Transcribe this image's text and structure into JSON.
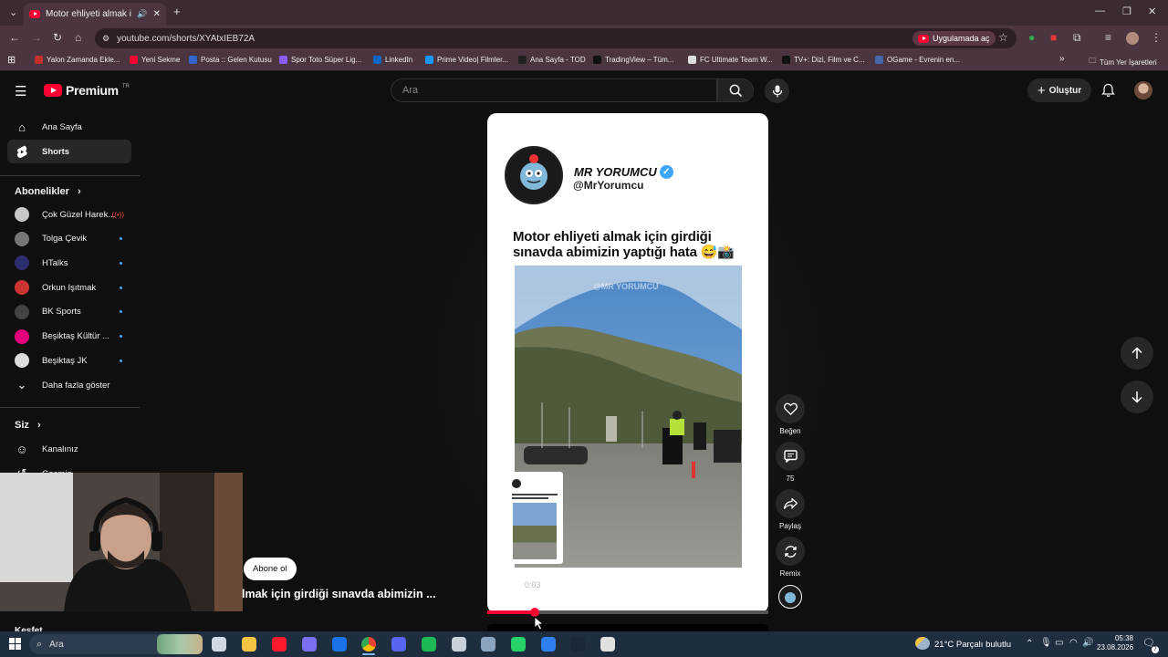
{
  "browser": {
    "tab_title": "Motor ehliyeti almak için gi",
    "url": "youtube.com/shorts/XYAtxIEB72A",
    "open_in_app": "Uygulamada aç",
    "all_bookmarks": "Tüm Yer İşaretleri",
    "bookmarks": [
      {
        "label": "Yalon Zamanda Ekle...",
        "color": "#c4302b"
      },
      {
        "label": "Yeni Sekme",
        "color": "#ff0033"
      },
      {
        "label": "Posta :: Gelen Kutusu",
        "color": "#3366cc"
      },
      {
        "label": "Spor Toto Süper Lig...",
        "color": "#8a5cf6"
      },
      {
        "label": "LinkedIn",
        "color": "#0a66c2"
      },
      {
        "label": "Prime Video| Filmler...",
        "color": "#1a98ff"
      },
      {
        "label": "Ana Sayfa - TOD",
        "color": "#222222"
      },
      {
        "label": "TradingView – Tüm...",
        "color": "#111111"
      },
      {
        "label": "FC Ultimate Team W...",
        "color": "#dddddd"
      },
      {
        "label": "TV+: Dizi, Film ve C...",
        "color": "#111111"
      },
      {
        "label": "OGame - Evrenin en...",
        "color": "#4466aa"
      }
    ]
  },
  "youtube": {
    "logo_text": "Premium",
    "logo_sup": "TR",
    "search_placeholder": "Ara",
    "create_label": "Oluştur"
  },
  "sidebar": {
    "home": "Ana Sayfa",
    "shorts": "Shorts",
    "subs_header": "Abonelikler",
    "subs": [
      {
        "name": "Çok Güzel Harek...",
        "color": "#c8c8c8",
        "live": true
      },
      {
        "name": "Tolga Çevik",
        "color": "#777777",
        "live": false
      },
      {
        "name": "HTalks",
        "color": "#2d2d6b",
        "live": false
      },
      {
        "name": "Orkun Işıtmak",
        "color": "#cc3333",
        "live": false
      },
      {
        "name": "BK Sports",
        "color": "#444444",
        "live": false
      },
      {
        "name": "Beşiktaş Kültür ...",
        "color": "#e6007e",
        "live": false
      },
      {
        "name": "Beşiktaş JK",
        "color": "#dddddd",
        "live": false
      }
    ],
    "show_more": "Daha fazla göster",
    "you_header": "Siz",
    "channel": "Kanalınız",
    "history": "Geçmiş",
    "explore_header": "Keşfet"
  },
  "short": {
    "channel_name": "MR YORUMCU",
    "handle": "@MrYorumcu",
    "caption": "Motor ehliyeti almak için girdiği sınavda abimizin yaptığı hata 😅📸",
    "watermark": "@MR YORUMCU",
    "timestamp": "0:03",
    "progress": 0.17,
    "overlay_title": "lmak için girdiği sınavda abimizin ...",
    "subscribe": "Abone ol",
    "like": "Beğen",
    "comments": "75",
    "share": "Paylaş",
    "remix": "Remix"
  },
  "taskbar": {
    "search": "Ara",
    "weather": "21°C  Parçalı bulutlu",
    "time": "05:38",
    "date": "23.08.2026",
    "notif_count": "7"
  },
  "colors": {
    "youtube_red": "#ff0033",
    "browser_frame": "#4a3540",
    "taskbar": "#1e2e3f",
    "verified": "#3ea6ff"
  }
}
